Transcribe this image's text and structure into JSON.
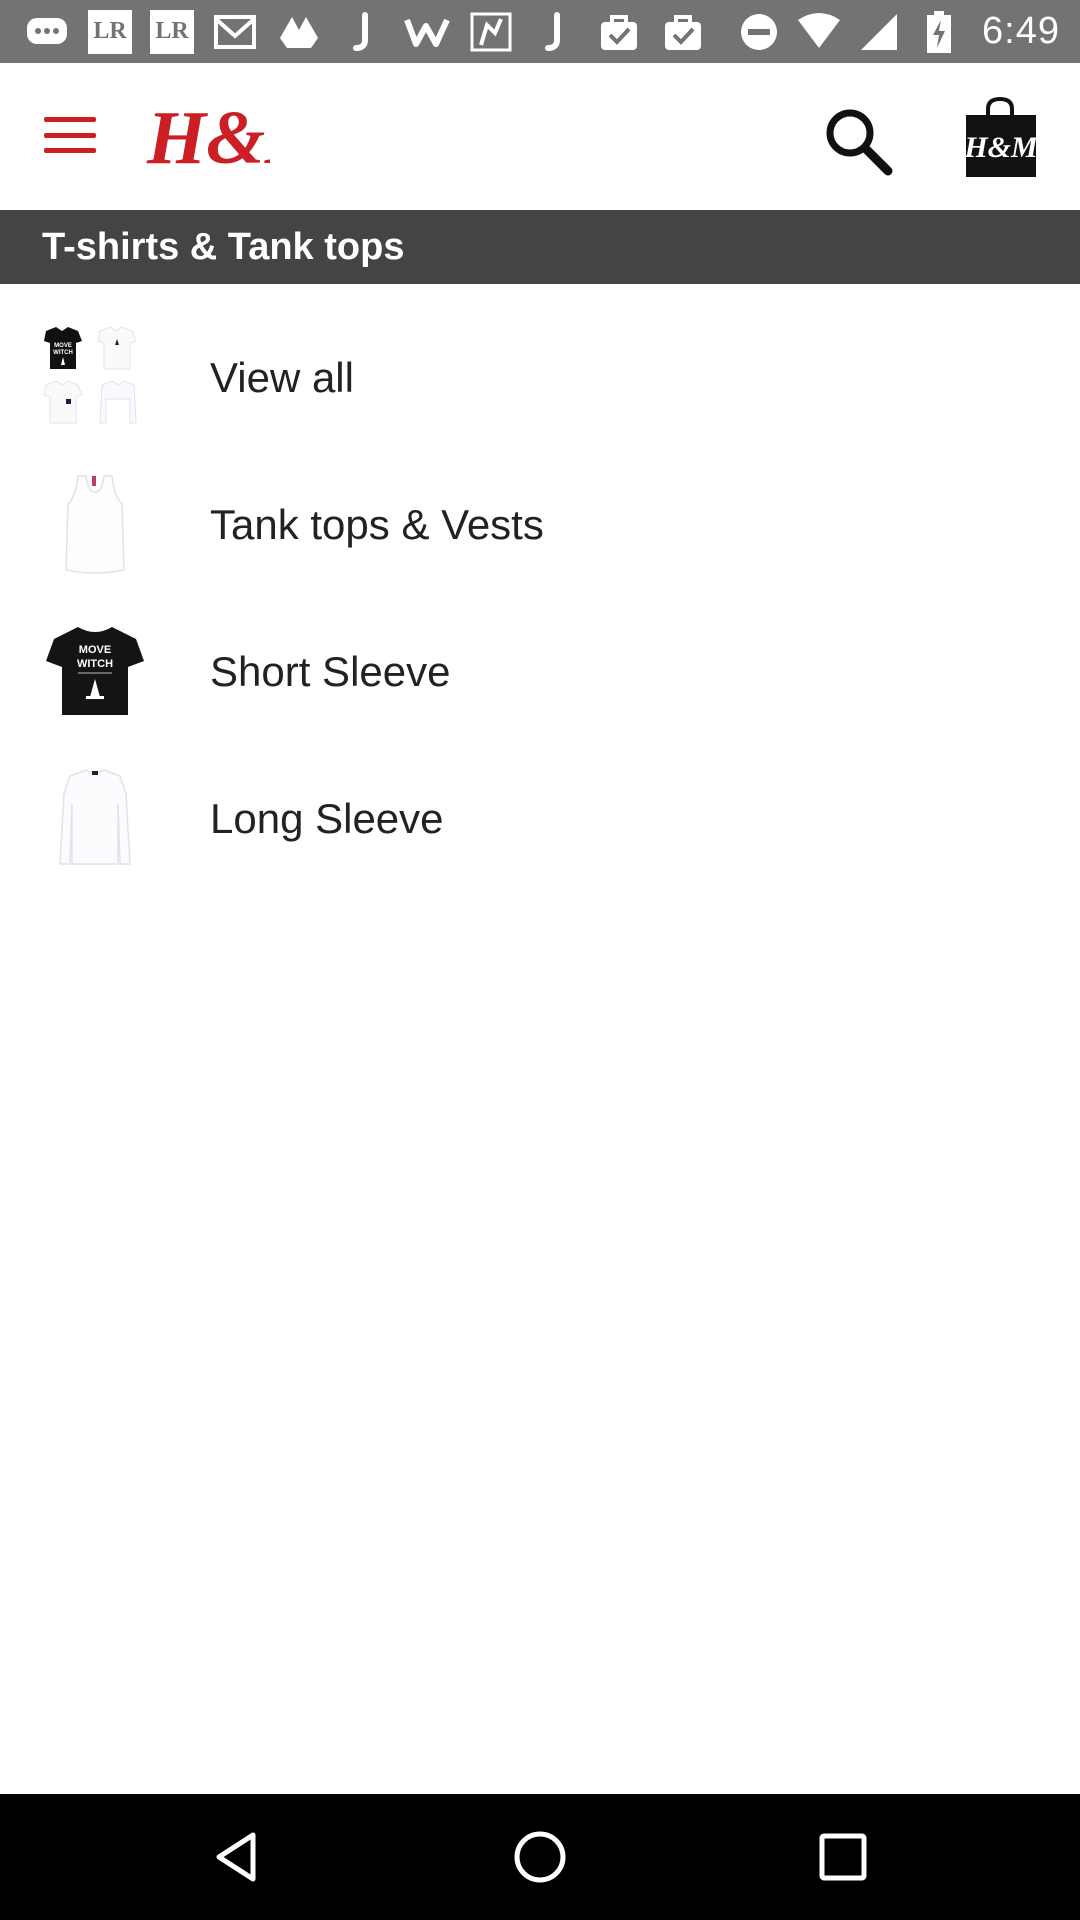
{
  "status_bar": {
    "time": "6:49",
    "notification_icons": [
      "chat-icon",
      "lr-icon",
      "lr-icon",
      "mail-icon",
      "drive-icon",
      "j-icon",
      "w-icon",
      "map-icon",
      "j-icon",
      "bag-check-icon",
      "bag-check-icon"
    ],
    "lr_label": "LR",
    "system_icons": [
      "dnd-icon",
      "wifi-icon",
      "signal-icon",
      "battery-charging-icon"
    ]
  },
  "header": {
    "logo_text": "H&M",
    "bag_logo_text": "H&M",
    "brand_color": "#cc1f25"
  },
  "section": {
    "title": "T-shirts & Tank tops"
  },
  "categories": [
    {
      "label": "View all",
      "thumb": "grid-tshirts-thumbnail"
    },
    {
      "label": "Tank tops & Vests",
      "thumb": "tank-top-thumbnail"
    },
    {
      "label": "Short Sleeve",
      "thumb": "black-tshirt-thumbnail"
    },
    {
      "label": "Long Sleeve",
      "thumb": "white-longsleeve-thumbnail"
    }
  ],
  "thumb_text": {
    "move": "MOVE",
    "witch": "WITCH"
  },
  "nav_bar": {
    "buttons": [
      "back-icon",
      "home-icon",
      "recents-icon"
    ]
  }
}
